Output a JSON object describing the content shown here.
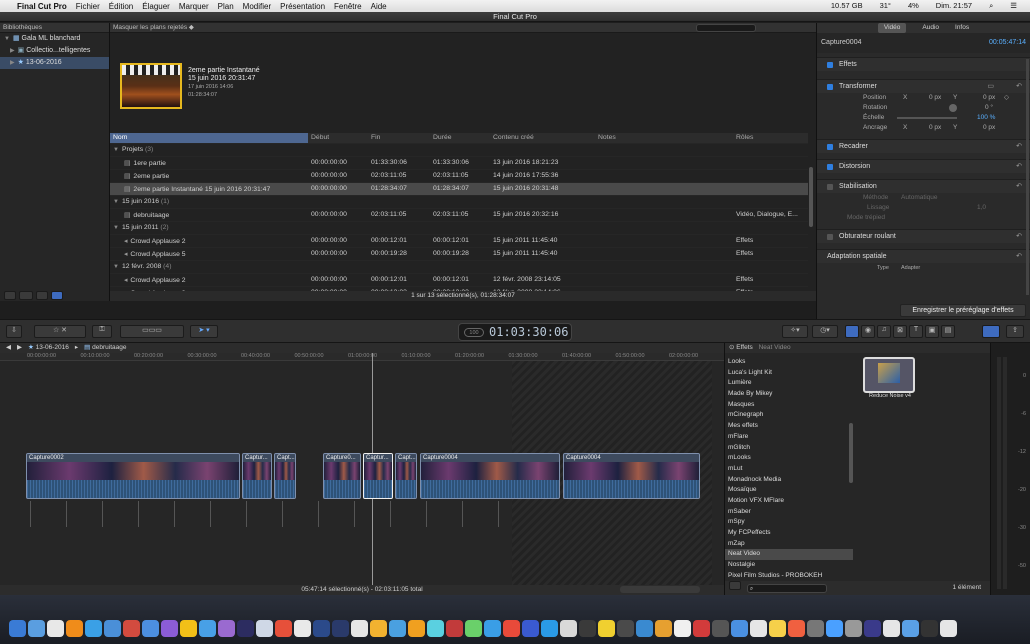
{
  "menubar": {
    "apple": "",
    "app": "Final Cut Pro",
    "items": [
      "Fichier",
      "Édition",
      "Élaguer",
      "Marquer",
      "Plan",
      "Modifier",
      "Présentation",
      "Fenêtre",
      "Aide"
    ],
    "status": [
      "10.57 GB",
      "31°",
      "4%",
      "Dim. 21:57"
    ]
  },
  "window_title": "Final Cut Pro",
  "library": {
    "header": "Bibliothèques",
    "items": [
      "Gala ML blanchard",
      "Collectio...telligentes",
      "13-06-2016"
    ]
  },
  "browser": {
    "filter": "Masquer les plans rejetés",
    "clip": {
      "name": "2eme partie Instantané",
      "date": "15 juin 2016 20:31:47",
      "sub_date": "17 juin 2016 14:06",
      "duration": "01:28:34:07"
    },
    "columns": [
      "Nom",
      "Début",
      "Fin",
      "Durée",
      "Contenu créé",
      "Notes",
      "Rôles"
    ],
    "rows": [
      {
        "type": "group",
        "name": "Projets",
        "count": "(3)"
      },
      {
        "type": "item",
        "name": "1ere partie",
        "start": "00:00:00:00",
        "end": "01:33:30:06",
        "dur": "01:33:30:06",
        "created": "13 juin 2016 18:21:23",
        "roles": ""
      },
      {
        "type": "item",
        "name": "2eme partie",
        "start": "00:00:00:00",
        "end": "02:03:11:05",
        "dur": "02:03:11:05",
        "created": "14 juin 2016 17:55:36",
        "roles": ""
      },
      {
        "type": "item",
        "sel": true,
        "name": "2eme partie Instantané 15 juin 2016 20:31:47",
        "start": "00:00:00:00",
        "end": "01:28:34:07",
        "dur": "01:28:34:07",
        "created": "15 juin 2016 20:31:48",
        "roles": ""
      },
      {
        "type": "group",
        "name": "15 juin 2016",
        "count": "(1)"
      },
      {
        "type": "item",
        "name": "debruitaage",
        "start": "00:00:00:00",
        "end": "02:03:11:05",
        "dur": "02:03:11:05",
        "created": "15 juin 2016 20:32:16",
        "roles": "Vidéo, Dialogue, E..."
      },
      {
        "type": "group",
        "name": "15 juin 2011",
        "count": "(2)"
      },
      {
        "type": "item",
        "name": "Crowd Applause 2",
        "start": "00:00:00:00",
        "end": "00:00:12:01",
        "dur": "00:00:12:01",
        "created": "15 juin 2011 11:45:40",
        "roles": "Effets"
      },
      {
        "type": "item",
        "name": "Crowd Applause 5",
        "start": "00:00:00:00",
        "end": "00:00:19:28",
        "dur": "00:00:19:28",
        "created": "15 juin 2011 11:45:40",
        "roles": "Effets"
      },
      {
        "type": "group",
        "name": "12 févr. 2008",
        "count": "(4)"
      },
      {
        "type": "item",
        "name": "Crowd Applause 2",
        "start": "00:00:00:00",
        "end": "00:00:12:01",
        "dur": "00:00:12:01",
        "created": "12 févr. 2008 23:14:05",
        "roles": "Effets"
      },
      {
        "type": "item",
        "name": "Crowd Applause 3",
        "start": "00:00:00:00",
        "end": "00:00:13:03",
        "dur": "00:00:13:03",
        "created": "12 févr. 2008 23:14:06",
        "roles": "Effets"
      }
    ],
    "status": "1 sur 13 sélectionné(s), 01:28:34:07"
  },
  "inspector": {
    "tabs": [
      "Vidéo",
      "Audio",
      "Infos"
    ],
    "clip_name": "Capture0004",
    "clip_tc": "00:05:47:14",
    "sections": {
      "effets": "Effets",
      "transformer": "Transformer",
      "position": "Position",
      "x_label": "X",
      "x_val": "0 px",
      "y_label": "Y",
      "y_val": "0 px",
      "rotation": "Rotation",
      "rotation_val": "0 °",
      "echelle": "Échelle",
      "echelle_val": "100 %",
      "ancrage": "Ancrage",
      "ancrage_x": "0 px",
      "ancrage_y": "0 px",
      "recadrer": "Recadrer",
      "distorsion": "Distorsion",
      "stabilisation": "Stabilisation",
      "methode": "Méthode",
      "methode_val": "Automatique",
      "lissage": "Lissage",
      "lissage_val": "1,0",
      "mode_trepied": "Mode trépied",
      "obturateur": "Obturateur roulant",
      "adaptation": "Adaptation spatiale",
      "type": "Type",
      "type_val": "Adapter"
    },
    "save_button": "Enregistrer le préréglage d'effets"
  },
  "toolbar": {
    "timecode": "01:03:30:06",
    "tc_small": "100"
  },
  "timeline": {
    "breadcrumb_event": "13-06-2016",
    "breadcrumb_project": "debruitaage",
    "ruler": [
      "00:00:00:00",
      "00:10:00:00",
      "00:20:00:00",
      "00:30:00:00",
      "00:40:00:00",
      "00:50:00:00",
      "01:00:00:00",
      "01:10:00:00",
      "01:20:00:00",
      "01:30:00:00",
      "01:40:00:00",
      "01:50:00:00",
      "02:00:00:00"
    ],
    "clips": [
      "Capture0002",
      "Captur...",
      "Capt...",
      "Capture0...",
      "Captur...",
      "Capt...",
      "Capture0004",
      "Capture0004"
    ],
    "status": "05:47:14 sélectionné(s) - 02:03:11:05 total"
  },
  "effects": {
    "header": "Effets",
    "subheader": "Neat Video",
    "list": [
      "Looks",
      "Luca's Light Kit",
      "Lumière",
      "Made By Mikey",
      "Masques",
      "mCinegraph",
      "Mes effets",
      "mFlare",
      "mGlitch",
      "mLooks",
      "mLut",
      "Monadnock Media",
      "Mosaïque",
      "Motion VFX MFlare",
      "mSaber",
      "mSpy",
      "My FCPeffects",
      "mZap",
      "Neat Video",
      "Nostalgie",
      "Pixel Film Studios - PROBOKEH"
    ],
    "selected": "Neat Video",
    "item": "Reduce Noise v4",
    "count": "1 élément"
  },
  "meter": [
    "0",
    "-6",
    "-12",
    "-20",
    "-30",
    "-50"
  ]
}
